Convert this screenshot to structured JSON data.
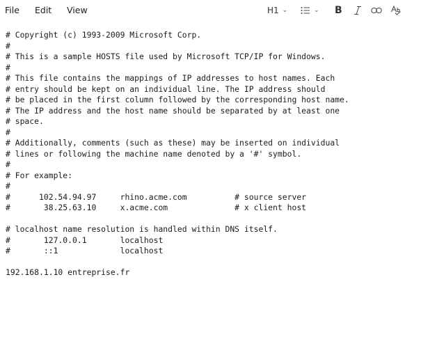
{
  "menu": {
    "file": "File",
    "edit": "Edit",
    "view": "View"
  },
  "toolbar": {
    "heading": "H1"
  },
  "hosts_file": {
    "lines": [
      "# Copyright (c) 1993-2009 Microsoft Corp.",
      "#",
      "# This is a sample HOSTS file used by Microsoft TCP/IP for Windows.",
      "#",
      "# This file contains the mappings of IP addresses to host names. Each",
      "# entry should be kept on an individual line. The IP address should",
      "# be placed in the first column followed by the corresponding host name.",
      "# The IP address and the host name should be separated by at least one",
      "# space.",
      "#",
      "# Additionally, comments (such as these) may be inserted on individual",
      "# lines or following the machine name denoted by a '#' symbol.",
      "#",
      "# For example:",
      "#",
      "#      102.54.94.97     rhino.acme.com          # source server",
      "#       38.25.63.10     x.acme.com              # x client host",
      "",
      "# localhost name resolution is handled within DNS itself.",
      "#       127.0.0.1       localhost",
      "#       ::1             localhost",
      "",
      "192.168.1.10 entreprise.fr"
    ]
  }
}
